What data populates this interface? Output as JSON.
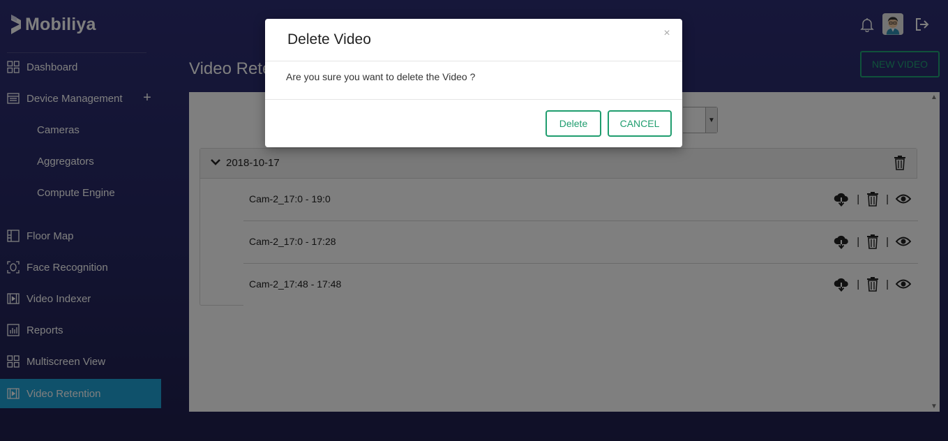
{
  "brand": {
    "name": "Mobiliya"
  },
  "sidebar": {
    "items": [
      {
        "label": "Dashboard",
        "icon": "grid-icon"
      },
      {
        "label": "Device Management",
        "icon": "list-icon",
        "expand_symbol": "+"
      },
      {
        "label": "Cameras"
      },
      {
        "label": "Aggregators"
      },
      {
        "label": "Compute Engine"
      },
      {
        "label": "Floor Map",
        "icon": "floor-map-icon"
      },
      {
        "label": "Face Recognition",
        "icon": "face-scan-icon"
      },
      {
        "label": "Video Indexer",
        "icon": "film-icon"
      },
      {
        "label": "Reports",
        "icon": "bar-chart-icon"
      },
      {
        "label": "Multiscreen View",
        "icon": "grid-icon"
      },
      {
        "label": "Video Retention",
        "icon": "film-icon",
        "active": true
      }
    ]
  },
  "header": {
    "page_title": "Video Retention",
    "new_video_label": "NEW VIDEO",
    "icons": [
      "bell-icon",
      "avatar",
      "logout-icon"
    ]
  },
  "retention": {
    "date_group": "2018-10-17",
    "videos": [
      {
        "name": "Cam-2_17:0 - 19:0"
      },
      {
        "name": "Cam-2_17:0 - 17:28"
      },
      {
        "name": "Cam-2_17:48 - 17:48"
      }
    ],
    "row_separator": "|"
  },
  "modal": {
    "title": "Delete Video",
    "close_symbol": "×",
    "message": "Are you sure you want to delete the Video ?",
    "delete_label": "Delete",
    "cancel_label": "CANCEL"
  },
  "colors": {
    "accent_green": "#1f9d6e",
    "active_nav": "#1fa2d6",
    "background": "#2b2c6e"
  }
}
